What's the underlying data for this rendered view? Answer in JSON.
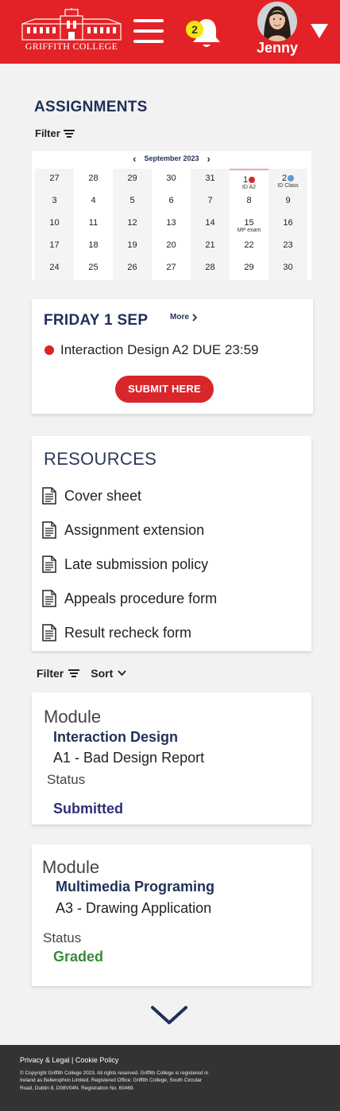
{
  "header": {
    "logo_text": "GRIFFITH COLLEGE",
    "notification_count": "2",
    "user_name": "Jenny",
    "brand_color": "#e32227"
  },
  "page": {
    "title": "ASSIGNMENTS",
    "filter_label": "Filter"
  },
  "calendar": {
    "month_label": "September 2023",
    "weeks": [
      [
        {
          "d": "27"
        },
        {
          "d": "28"
        },
        {
          "d": "29"
        },
        {
          "d": "30"
        },
        {
          "d": "31"
        },
        {
          "d": "1",
          "dot": "#d9262b",
          "note": "ID A2"
        },
        {
          "d": "2",
          "dot": "#5b9bd5",
          "note": "ID Class"
        }
      ],
      [
        {
          "d": "3"
        },
        {
          "d": "4"
        },
        {
          "d": "5"
        },
        {
          "d": "6"
        },
        {
          "d": "7"
        },
        {
          "d": "8"
        },
        {
          "d": "9"
        }
      ],
      [
        {
          "d": "10"
        },
        {
          "d": "11"
        },
        {
          "d": "12"
        },
        {
          "d": "13"
        },
        {
          "d": "14"
        },
        {
          "d": "15",
          "note": "MP exam"
        },
        {
          "d": "16"
        }
      ],
      [
        {
          "d": "17"
        },
        {
          "d": "18"
        },
        {
          "d": "19"
        },
        {
          "d": "20"
        },
        {
          "d": "21"
        },
        {
          "d": "22"
        },
        {
          "d": "23"
        }
      ],
      [
        {
          "d": "24"
        },
        {
          "d": "25"
        },
        {
          "d": "26"
        },
        {
          "d": "27"
        },
        {
          "d": "28"
        },
        {
          "d": "29"
        },
        {
          "d": "30"
        }
      ]
    ]
  },
  "day_card": {
    "title": "FRIDAY 1 SEP",
    "more_label": "More",
    "due_text": "Interaction Design A2 DUE 23:59",
    "submit_label": "SUBMIT HERE"
  },
  "resources": {
    "title": "RESOURCES",
    "items": [
      {
        "label": "Cover sheet"
      },
      {
        "label": "Assignment extension"
      },
      {
        "label": "Late submission policy"
      },
      {
        "label": "Appeals procedure form"
      },
      {
        "label": "Result recheck form"
      }
    ]
  },
  "list_controls": {
    "filter_label": "Filter",
    "sort_label": "Sort"
  },
  "modules": [
    {
      "label": "Module",
      "name": "Interaction Design",
      "assignment": "A1 - Bad Design Report",
      "status_label": "Status",
      "status": "Submitted",
      "status_color": "#2e2f7a"
    },
    {
      "label": "Module",
      "name": "Multimedia Programing",
      "assignment": "A3 - Drawing Application",
      "status_label": "Status",
      "status": "Graded",
      "status_color": "#3a8a3a"
    }
  ],
  "footer": {
    "links": "Privacy & Legal  |  Cookie Policy",
    "copyright": "© Copyright Griffith College 2023. All rights reserved. Griffith College is registered in Ireland as Bellerophon Limited. Registered Office: Griffith College, South Circular Road, Dublin 8, D08V04N. Registration No. 60469."
  }
}
